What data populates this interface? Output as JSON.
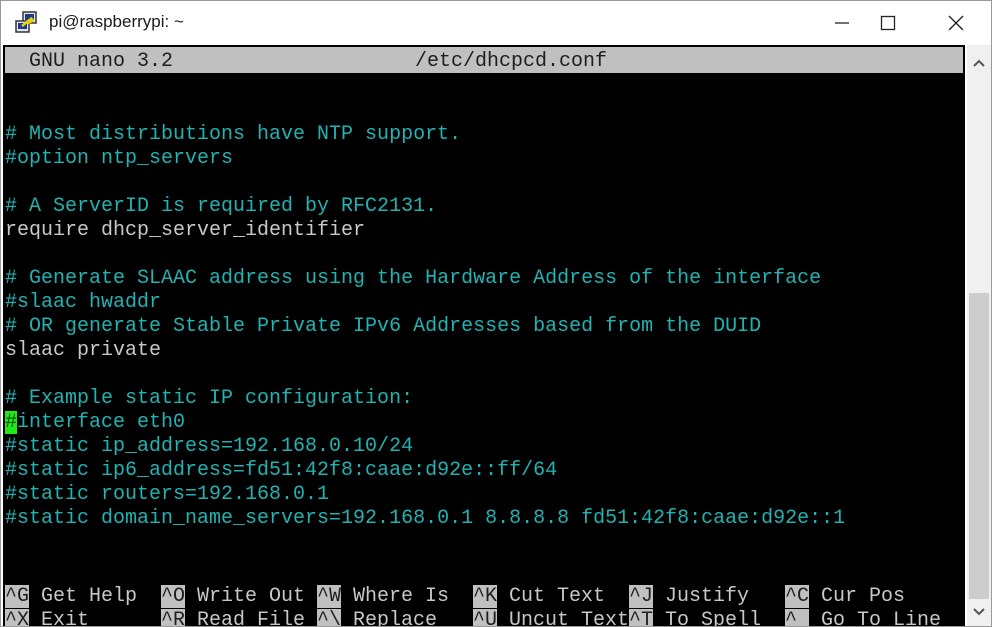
{
  "window": {
    "title": "pi@raspberrypi: ~",
    "icon": "putty-icon",
    "controls": {
      "minimize": "minimize-icon",
      "maximize": "maximize-icon",
      "close": "close-icon"
    }
  },
  "nano": {
    "version": "GNU nano 3.2",
    "filename": "/etc/dhcpcd.conf"
  },
  "colors": {
    "comment": "#22b2b2",
    "plain": "#c8c8c8",
    "header_bg": "#c0c0c0",
    "cursor_bg": "#22e81a",
    "background": "#000000"
  },
  "editor": {
    "lines": [
      {
        "text": "",
        "type": "plain"
      },
      {
        "text": "",
        "type": "plain"
      },
      {
        "text": "# Most distributions have NTP support.",
        "type": "comment"
      },
      {
        "text": "#option ntp_servers",
        "type": "comment"
      },
      {
        "text": "",
        "type": "plain"
      },
      {
        "text": "# A ServerID is required by RFC2131.",
        "type": "comment"
      },
      {
        "text": "require dhcp_server_identifier",
        "type": "plain"
      },
      {
        "text": "",
        "type": "plain"
      },
      {
        "text": "# Generate SLAAC address using the Hardware Address of the interface",
        "type": "comment"
      },
      {
        "text": "#slaac hwaddr",
        "type": "comment"
      },
      {
        "text": "# OR generate Stable Private IPv6 Addresses based from the DUID",
        "type": "comment"
      },
      {
        "text": "slaac private",
        "type": "plain"
      },
      {
        "text": "",
        "type": "plain"
      },
      {
        "text": "# Example static IP configuration:",
        "type": "comment"
      },
      {
        "text": "#interface eth0",
        "type": "comment",
        "cursor_at": 0
      },
      {
        "text": "#static ip_address=192.168.0.10/24",
        "type": "comment"
      },
      {
        "text": "#static ip6_address=fd51:42f8:caae:d92e::ff/64",
        "type": "comment"
      },
      {
        "text": "#static routers=192.168.0.1",
        "type": "comment"
      },
      {
        "text": "#static domain_name_servers=192.168.0.1 8.8.8.8 fd51:42f8:caae:d92e::1",
        "type": "comment"
      },
      {
        "text": "",
        "type": "plain"
      },
      {
        "text": "",
        "type": "plain"
      }
    ]
  },
  "shortcuts": {
    "row1": [
      {
        "key": "^G",
        "label": "Get Help"
      },
      {
        "key": "^O",
        "label": "Write Out"
      },
      {
        "key": "^W",
        "label": "Where Is"
      },
      {
        "key": "^K",
        "label": "Cut Text"
      },
      {
        "key": "^J",
        "label": "Justify"
      },
      {
        "key": "^C",
        "label": "Cur Pos"
      }
    ],
    "row2": [
      {
        "key": "^X",
        "label": "Exit"
      },
      {
        "key": "^R",
        "label": "Read File"
      },
      {
        "key": "^\\",
        "label": "Replace"
      },
      {
        "key": "^U",
        "label": "Uncut Text"
      },
      {
        "key": "^T",
        "label": "To Spell"
      },
      {
        "key": "^_",
        "label": "Go To Line"
      }
    ]
  },
  "scrollbar": {
    "up": "chevron-up-icon",
    "down": "chevron-down-icon"
  }
}
